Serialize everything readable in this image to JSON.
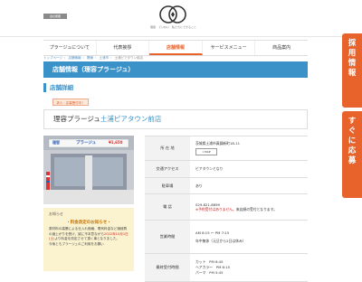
{
  "header": {
    "corp_badge": "会社概要",
    "logo_tagline": "理容　ていねい　私たちにできること"
  },
  "nav": [
    {
      "label": "プラージュについて"
    },
    {
      "label": "代表挨拶"
    },
    {
      "label": "店舗情報"
    },
    {
      "label": "サービスメニュー"
    },
    {
      "label": "商品案内"
    }
  ],
  "breadcrumb": [
    "トップページ",
    "店舗情報",
    "関東",
    "土浦市",
    "土浦ピアタウン前店"
  ],
  "page": {
    "title": "店舗情報（理容プラージュ）",
    "section_heading": "店舗詳細",
    "recruit_badge": "求人・応募受付中！",
    "store_name_prefix": "理容プラージュ",
    "store_name_accent": "土浦ピアタウン前店"
  },
  "photo": {
    "sign_left": "理容",
    "sign_center": "プラージュ",
    "sign_price": "¥1,650"
  },
  "notice": {
    "title": "お知らせ",
    "headline": "・料金改定のお知らせ・",
    "body_1": "原材料の高騰による仕入れ価格、電気料金など諸経費の値上がりを受け、誠に不本意ながら",
    "body_red": "2022年10月1日(土)",
    "body_2": "より料金を改定させて頂く事となりました。",
    "body_3": "今後ともプラージュのご利用をお願い"
  },
  "info": {
    "address_label": "所 在 地",
    "address_value": "茨城県土浦市真鍋新町18-11",
    "map_button": "MAP",
    "access_label": "交通アクセス",
    "access_value": "ピアタウンとなり",
    "parking_label": "駐車場",
    "parking_value": "あり",
    "phone_label": "電 話",
    "phone_value": "029-821-8899",
    "phone_note_red": "※予約受付はありません。",
    "phone_note": "来店順の受付となります。",
    "hours_label": "営業時間",
    "hours_value": "AM 8:15 ～ PM 7:15",
    "hours_note": "年中無休（元旦から2日は休み）",
    "price_label": "最終受付時間",
    "price_1": "カット　PM 6:45",
    "price_2": "ヘアカラー　PM 6:15",
    "price_3": "パーマ　PM 5:45"
  },
  "side": {
    "recruit": [
      "採",
      "用",
      "情",
      "報"
    ],
    "apply": [
      "す",
      "ぐ",
      "に",
      "応",
      "募"
    ]
  },
  "colors": {
    "accent_blue": "#3b92c9",
    "accent_orange": "#e8632b",
    "alert_red": "#d01818",
    "notice_bg": "#fbf3cf"
  }
}
